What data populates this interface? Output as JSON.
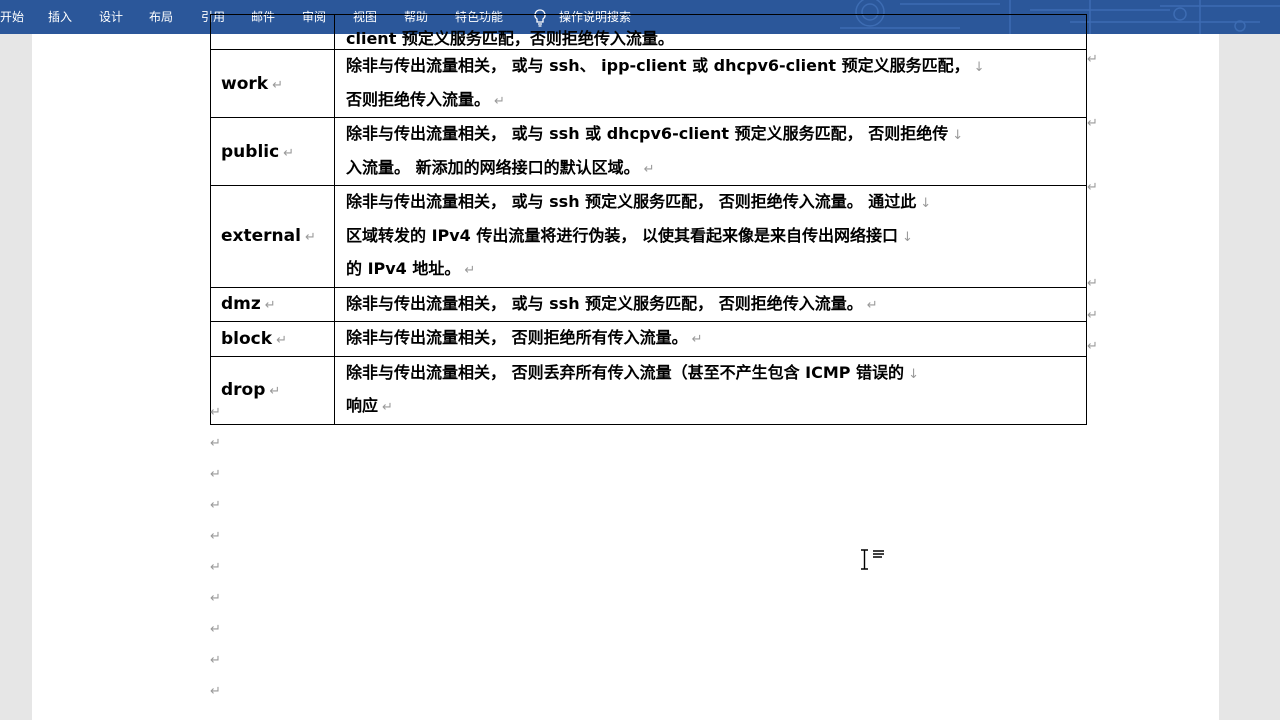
{
  "ribbon": {
    "tabs": [
      "开始",
      "插入",
      "设计",
      "布局",
      "引用",
      "邮件",
      "审阅",
      "视图",
      "帮助",
      "特色功能"
    ],
    "tell_me": "操作说明搜索",
    "background": "#2b579a"
  },
  "table": {
    "partial_top_text": "client 预定义服务匹配，否则拒绝传入流量。",
    "rows": [
      {
        "zone": "work",
        "lines": [
          "除非与传出流量相关， 或与 ssh、 ipp-client 或 dhcpv6-client 预定义服务匹配，",
          "否则拒绝传入流量。"
        ]
      },
      {
        "zone": "public",
        "lines": [
          "除非与传出流量相关， 或与 ssh 或 dhcpv6-client 预定义服务匹配， 否则拒绝传",
          "入流量。 新添加的网络接口的默认区域。"
        ]
      },
      {
        "zone": "external",
        "lines": [
          "除非与传出流量相关， 或与 ssh 预定义服务匹配， 否则拒绝传入流量。 通过此",
          "区域转发的 IPv4 传出流量将进行伪装， 以使其看起来像是来自传出网络接口",
          "的 IPv4 地址。"
        ]
      },
      {
        "zone": "dmz",
        "lines": [
          "除非与传出流量相关， 或与 ssh 预定义服务匹配， 否则拒绝传入流量。"
        ]
      },
      {
        "zone": "block",
        "lines": [
          "除非与传出流量相关， 否则拒绝所有传入流量。"
        ]
      },
      {
        "zone": "drop",
        "lines": [
          "除非与传出流量相关， 否则丢弃所有传入流量（甚至不产生包含 ICMP 错误的",
          "响应"
        ]
      }
    ]
  },
  "marks": {
    "paragraph": "↵",
    "line_break": "↓"
  }
}
